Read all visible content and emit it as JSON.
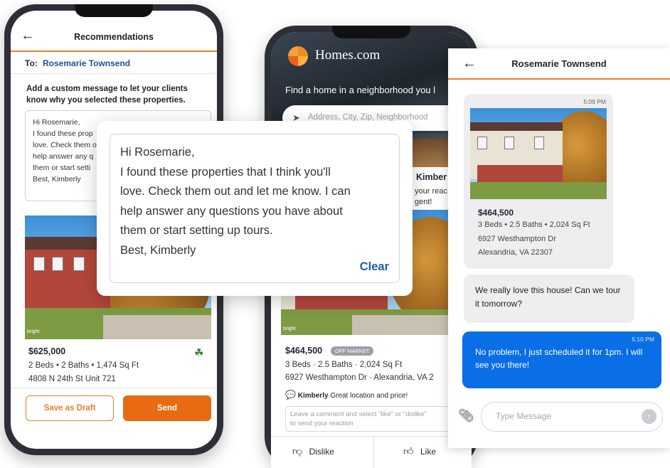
{
  "recommendations": {
    "title": "Recommendations",
    "to_label": "To:",
    "to_name": "Rosemarie Townsend",
    "instructions": "Add a custom message to let your clients know why you selected these properties.",
    "message_preview": "Hi Rosemarie,\nI found these prop\nlove. Check them o\nhelp answer any q\nthem or start setti\nBest, Kimberly",
    "listing": {
      "price": "$625,000",
      "details": "2 Beds • 2 Baths • 1,474 Sq Ft",
      "address": "4808 N 24th St Unit 721",
      "watermark": "bright"
    },
    "save_draft_label": "Save as Draft",
    "send_label": "Send"
  },
  "homes_app": {
    "logo": "Homes.com",
    "tagline": "Find a home in a neighborhood you l",
    "search_placeholder": "Address, City, Zip, Neighborhood",
    "peek_name": "Kimber",
    "peek_line1": "your reac",
    "peek_line2": "gent!",
    "listing": {
      "price": "$464,500",
      "badge": "OFF MARKET",
      "details": "3 Beds · 2.5 Baths · 2,024 Sq Ft",
      "address": "6927 Westhampton Dr · Alexandria, VA 2",
      "watermark": "bright"
    },
    "comment_author": "Kimberly",
    "comment_text": "Great location and price!",
    "comment_placeholder_1": "Leave a comment and select \"like\" or \"dislike\"",
    "comment_placeholder_2": "to send your reaction",
    "dislike_label": "Dislike",
    "like_label": "Like"
  },
  "popup": {
    "message": "Hi Rosemarie,\nI found these properties that I think you'll\nlove. Check them out and let me know. I can\nhelp answer any questions you have about\nthem or start setting up tours.\nBest, Kimberly",
    "clear_label": "Clear"
  },
  "chat": {
    "contact_name": "Rosemarie Townsend",
    "listing_time": "5:09 PM",
    "listing_price": "$464,500",
    "listing_details": "3 Beds • 2.5 Baths • 2,024 Sq Ft",
    "listing_address1": "6927 Westhampton Dr",
    "listing_address2": "Alexandria, VA 22307",
    "incoming_message": "We really love this house! Can we tour it tomorrow?",
    "reply_time": "5:10 PM",
    "reply_message": "No problem, I just scheduled it for 1pm. I will see you there!",
    "input_placeholder": "Type Message"
  },
  "colors": {
    "accent_orange": "#ef7d2a",
    "send_orange": "#e86a12",
    "link_blue": "#1f5ea8",
    "chat_blue": "#0a6ee6"
  }
}
